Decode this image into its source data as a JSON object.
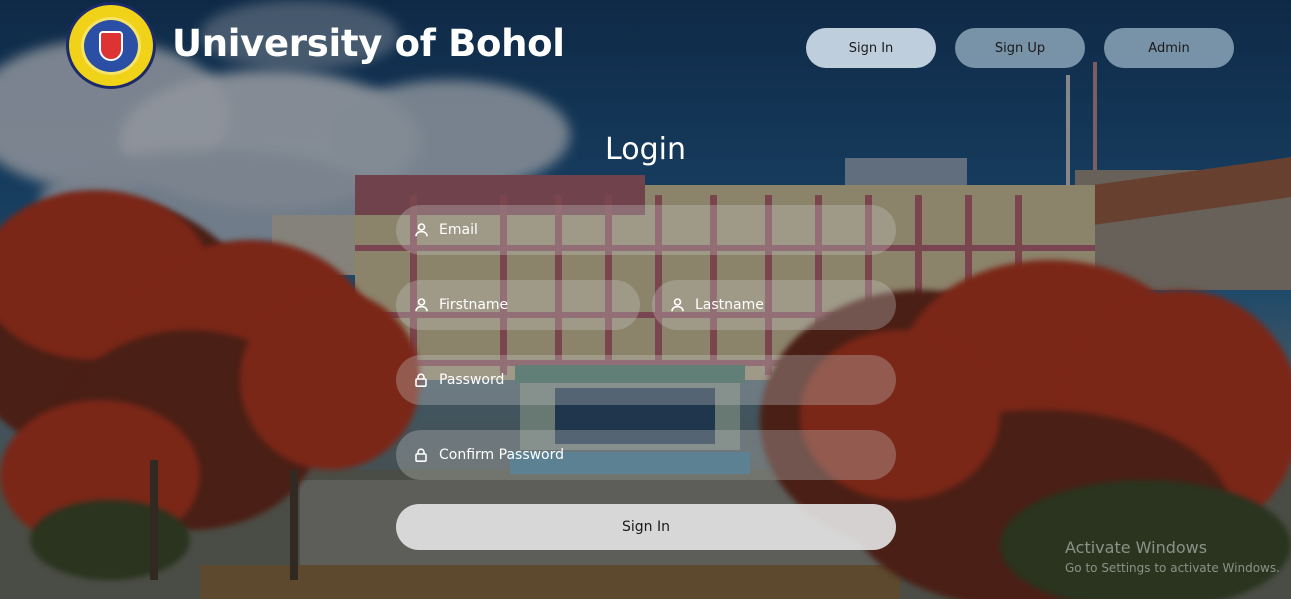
{
  "header": {
    "logo_alt": "University of Bohol seal",
    "brand": "University of Bohol",
    "nav": {
      "signin": "Sign In",
      "signup": "Sign Up",
      "admin": "Admin"
    }
  },
  "form": {
    "title": "Login",
    "email_placeholder": "Email",
    "firstname_placeholder": "Firstname",
    "lastname_placeholder": "Lastname",
    "password_placeholder": "Password",
    "confirm_placeholder": "Confirm Password",
    "submit_label": "Sign In"
  },
  "watermark": {
    "title": "Activate Windows",
    "subtitle": "Go to Settings to activate Windows."
  },
  "colors": {
    "accent": "#ffffff",
    "nav_active": "#d7e5f0",
    "nav_inactive": "#aac3d4",
    "field_bg": "#c8c8c8"
  },
  "icons": {
    "user": "user-icon",
    "lock": "lock-icon"
  }
}
